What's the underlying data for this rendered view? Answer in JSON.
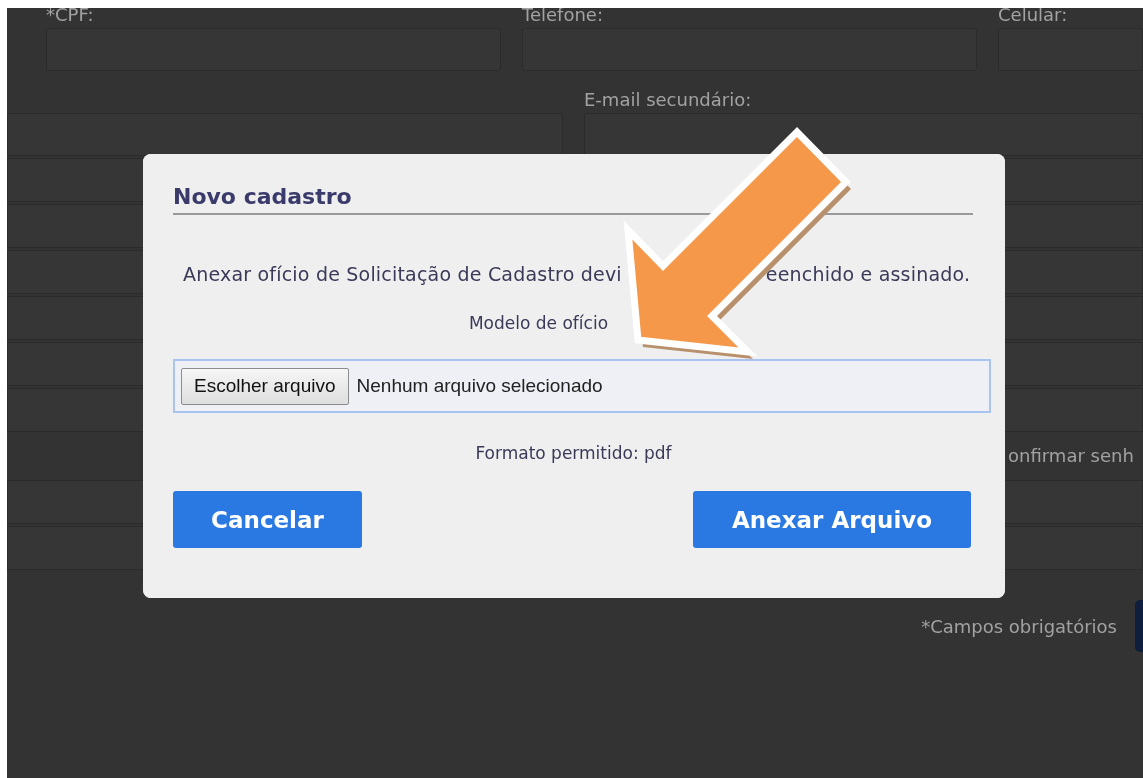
{
  "background_form": {
    "row_1_labels": [
      "*CPF:",
      "Telefone:",
      "Celular:"
    ],
    "secondary_email_label": "E-mail secundário:",
    "confirm_password_label": "onfirmar senh",
    "required_note": "*Campos obrigatórios"
  },
  "dialog": {
    "title": "Novo cadastro",
    "message_parts": [
      "Anexar ofício de Solicitação de Cadastro devi",
      "eenchido e assinado."
    ],
    "template_link": "Modelo de ofício",
    "file_input": {
      "button": "Escolher arquivo",
      "status": "Nenhum arquivo selecionado"
    },
    "format_note": "Formato permitido: pdf",
    "buttons": [
      "Cancelar",
      "Anexar Arquivo"
    ]
  }
}
